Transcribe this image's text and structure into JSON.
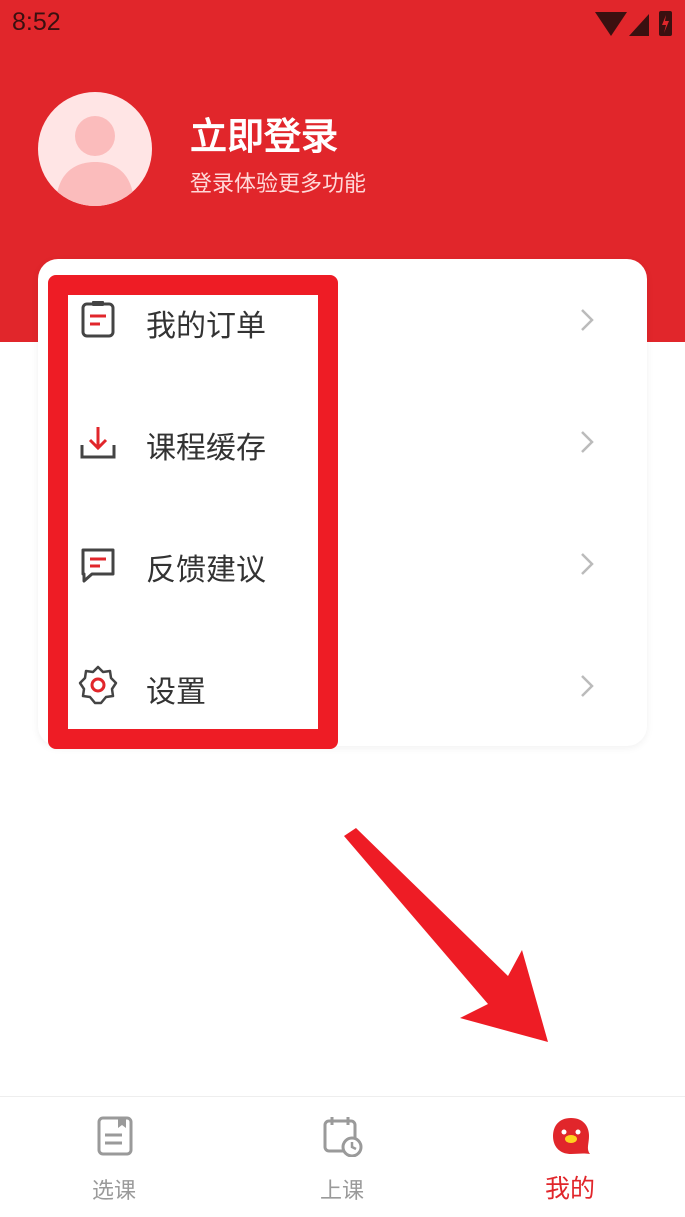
{
  "status_bar": {
    "time": "8:52"
  },
  "profile": {
    "login_title": "立即登录",
    "login_subtitle": "登录体验更多功能"
  },
  "menu": {
    "items": [
      {
        "label": "我的订单",
        "icon": "order-icon"
      },
      {
        "label": "课程缓存",
        "icon": "download-icon"
      },
      {
        "label": "反馈建议",
        "icon": "feedback-icon"
      },
      {
        "label": "设置",
        "icon": "gear-icon"
      }
    ]
  },
  "tabbar": {
    "tabs": [
      {
        "label": "选课",
        "icon": "book-icon",
        "active": false
      },
      {
        "label": "上课",
        "icon": "calendar-clock-icon",
        "active": false
      },
      {
        "label": "我的",
        "icon": "mascot-icon",
        "active": true
      }
    ]
  },
  "colors": {
    "brand": "#e1262b",
    "annotation": "#ee1c25",
    "inactive_tab": "#9a9a9a"
  }
}
